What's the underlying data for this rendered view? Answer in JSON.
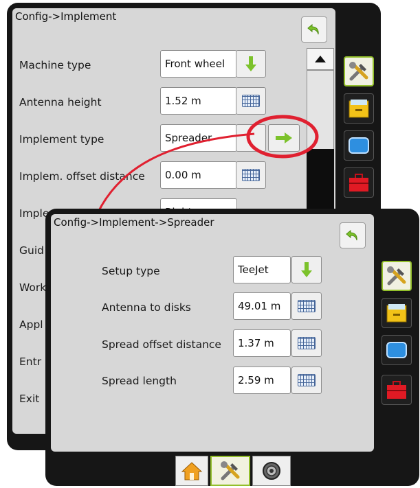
{
  "back_screen": {
    "title": "Config->Implement",
    "rows": [
      {
        "label": "Machine type",
        "value": "Front wheel"
      },
      {
        "label": "Antenna height",
        "value": "1.52 m"
      },
      {
        "label": "Implement type",
        "value": "Spreader"
      },
      {
        "label": "Implem. offset distance",
        "value": "0.00 m"
      },
      {
        "label": "Implem. offset direction",
        "value": "Right"
      }
    ],
    "partial_labels": [
      "Guid",
      "Work",
      "Appl",
      "Entr",
      "Exit"
    ]
  },
  "front_screen": {
    "title": "Config->Implement->Spreader",
    "rows": [
      {
        "label": "Setup type",
        "value": "TeeJet"
      },
      {
        "label": "Antenna to disks",
        "value": "49.01 m"
      },
      {
        "label": "Spread offset distance",
        "value": "1.37 m"
      },
      {
        "label": "Spread length",
        "value": "2.59 m"
      }
    ]
  },
  "icons": {
    "back": "undo-arrow-icon",
    "tools": "wrench-hammer-icon",
    "data": "file-drawer-icon",
    "display": "monitor-icon",
    "toolbox": "toolbox-icon",
    "home": "home-icon",
    "settings_dial": "dial-icon",
    "enter_arrow": "green-right-arrow-icon",
    "dropdown_arrow": "green-down-arrow-icon",
    "keyboard": "keyboard-icon"
  },
  "colors": {
    "accent_green": "#7cc22b",
    "highlight_red": "#e02030",
    "bezel": "#161616",
    "screen_bg": "#d7d7d7"
  }
}
